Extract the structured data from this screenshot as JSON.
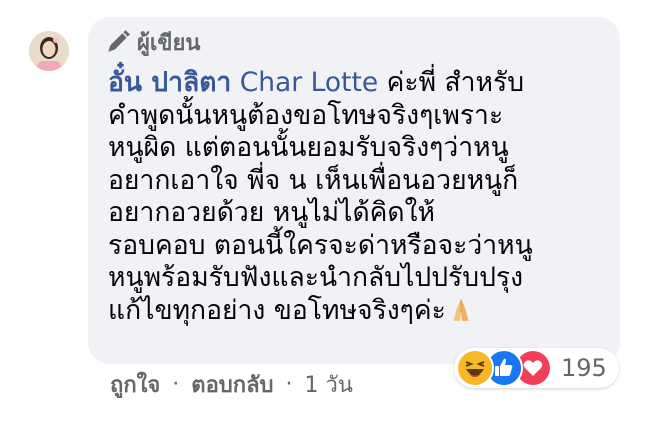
{
  "comment": {
    "badge_label": "ผู้เขียน",
    "author_name": "อั๋น ปาลิตา",
    "mention": "Char Lotte",
    "text_lines": [
      " ค่ะพี่ สำหรับ",
      "คำพูดนั้นหนูต้องขอโทษจริงๆเพราะ",
      "หนูผิด แต่ตอนนั้นยอมรับจริงๆว่าหนู",
      "อยากเอาใจ พี่จ น เห็นเพื่อนอวยหนูก็",
      "อยากอวยด้วย หนูไม่ได้คิดให้",
      "รอบคอบ ตอนนี้ใครจะด่าหรือจะว่าหนู",
      "หนูพร้อมรับฟังและนำกลับไปปรับปรุง",
      "แก้ไขทุกอย่าง ขอโทษจริงๆค่ะ"
    ],
    "end_emoji": "pray-icon"
  },
  "reactions": {
    "icons": [
      "haha-icon",
      "like-icon",
      "love-icon"
    ],
    "count": "195"
  },
  "actions": {
    "like_label": "ถูกใจ",
    "reply_label": "ตอบกลับ",
    "separator": "·",
    "time": "1 วัน"
  },
  "colors": {
    "bubble": "#f0f2f5",
    "link": "#385898",
    "muted": "#65676b",
    "text": "#050505"
  }
}
